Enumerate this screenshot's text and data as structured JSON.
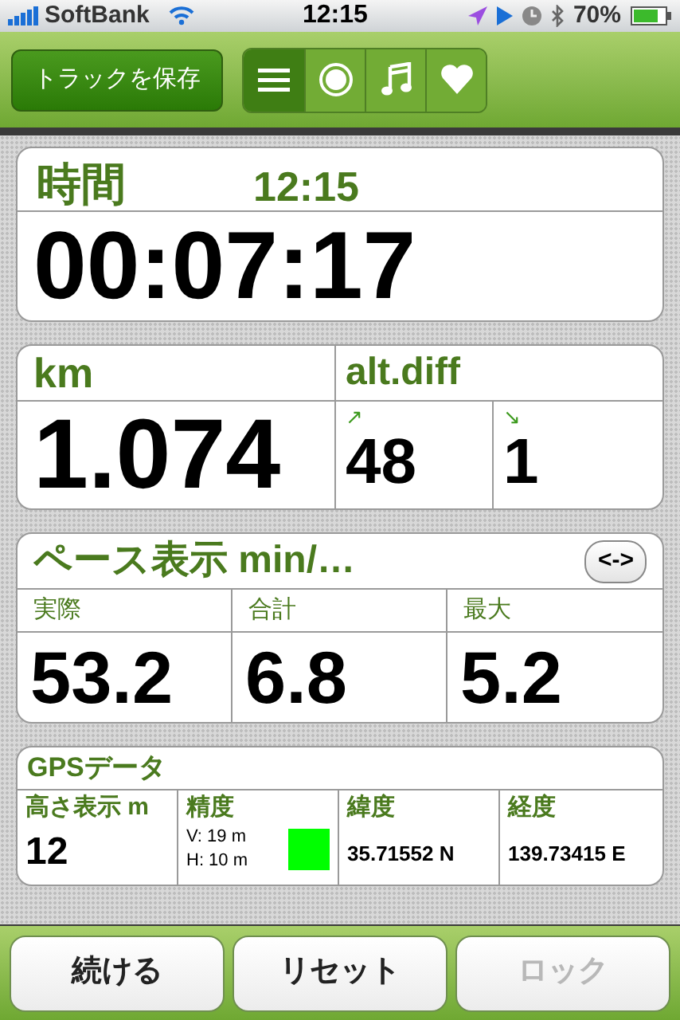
{
  "status_bar": {
    "carrier": "SoftBank",
    "time": "12:15",
    "battery": "70%"
  },
  "toolbar": {
    "save_button": "トラックを保存",
    "segments": [
      {
        "selected": true
      },
      {
        "selected": false
      },
      {
        "selected": false
      },
      {
        "selected": false
      }
    ]
  },
  "time_card": {
    "title": "時間",
    "clock": "12:15",
    "elapsed": "00:07:17"
  },
  "distance_card": {
    "title": "km",
    "value": "1.074",
    "alt_title": "alt.diff",
    "ascent": {
      "arrow": "↗",
      "value": "48"
    },
    "descent": {
      "arrow": "↘",
      "value": "1"
    }
  },
  "pace_card": {
    "title": "ペース表示 min/…",
    "toggle_button": "<->",
    "columns": [
      {
        "label": "実際",
        "value": "53.2"
      },
      {
        "label": "合計",
        "value": "6.8"
      },
      {
        "label": "最大",
        "value": "5.2"
      }
    ]
  },
  "gps_card": {
    "title": "GPSデータ",
    "altitude": {
      "label": "高さ表示 m",
      "value": "12"
    },
    "accuracy": {
      "label": "精度",
      "vertical": "V: 19 m",
      "horizontal": "H: 10 m",
      "color": "#00ff00"
    },
    "latitude": {
      "label": "緯度",
      "value": "35.71552 N"
    },
    "longitude": {
      "label": "経度",
      "value": "139.73415 E"
    }
  },
  "buttons": [
    {
      "label": "続ける",
      "disabled": false
    },
    {
      "label": "リセット",
      "disabled": false
    },
    {
      "label": "ロック",
      "disabled": true
    }
  ]
}
